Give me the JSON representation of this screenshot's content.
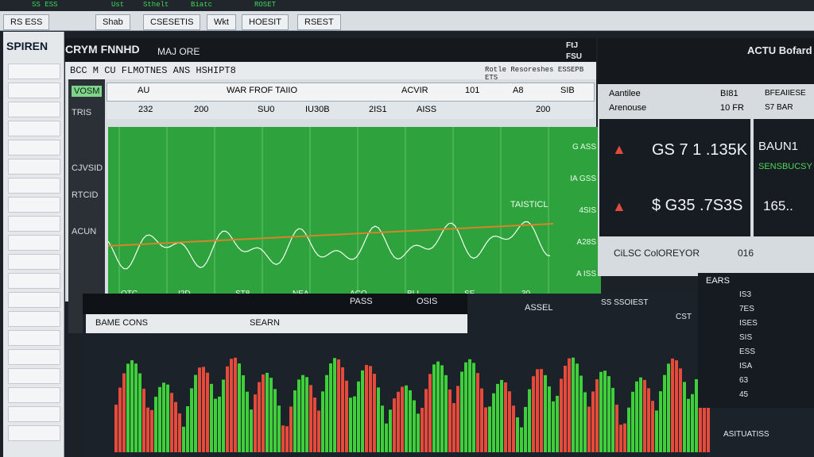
{
  "topbar": {
    "items": [
      "SS ESS",
      "Ust",
      "Sthelt",
      "Biatc",
      "ROSET"
    ]
  },
  "tabs": [
    "RS ESS",
    "Shab",
    "CSESETIS",
    "Wkt",
    "HOESIT",
    "RSEST"
  ],
  "sidebar": {
    "title": "SPIREN",
    "rows": [
      "",
      "",
      "",
      "",
      "",
      "",
      "",
      "",
      "",
      "",
      "",
      "",
      "",
      "",
      "",
      "",
      "",
      "",
      "",
      ""
    ]
  },
  "main_panel": {
    "title": "CRYM FNNHD",
    "subtitle": "MAJ ORE",
    "code_a": "FtJ",
    "code_b": "FSU",
    "header_strip": "BCC   M CU FLMOTNES ANS HSHIPT8",
    "header_right": "Rotle Resoreshes ESSEPB ETS",
    "toolbar": {
      "val_a": "AU",
      "label": "WAR FROF TAIIO",
      "sym": "ACVIR",
      "v1": "101",
      "v2": "A8",
      "v3": "SIB"
    },
    "row2": {
      "val_a": "232",
      "val_b": "200",
      "val_c": "SU0",
      "val_d": "IU30B",
      "val_e": "2IS1",
      "val_f": "AISS",
      "val_g": "200"
    },
    "side_labels": [
      "VOSM",
      "TRIS",
      "CJVSID",
      "RTCID",
      "ACUN"
    ],
    "chart_annotation": "TAISTICL",
    "x_ticks": [
      "OTC",
      "I2D",
      "ST8",
      "NEA",
      "ACO",
      "BLI",
      "SE",
      "30"
    ],
    "y_ticks": [
      "G ASS",
      "IA GSS",
      "4SIS",
      "A28S",
      "A ISS"
    ]
  },
  "info_panel": {
    "title": "ACTU Bofard",
    "top_labels": [
      "Aantilee",
      "BI81",
      "BFEAIIESE"
    ],
    "top_values": [
      "Arenouse",
      "10 FR",
      "S7 BAR"
    ],
    "metric_1": "GS 7 1 .135K",
    "metric_2": "$ G35 .7S3S",
    "side_a": "BAUN1",
    "side_b": "SENSBUCSY",
    "side_c": "165..",
    "footer": "CiLSC ColOREYOR",
    "footer_val": "016"
  },
  "bottom_panel": {
    "header_left": "BAME CONS",
    "header_mid": "SEARN",
    "header_right": "PASS",
    "header_far": "OSIS",
    "right_header": "ASSEL",
    "right_sub": "SS SSOIEST",
    "right_sub2": "CST",
    "footer": "ASITUATISS"
  },
  "orderbook": {
    "title": "EARS",
    "rows": [
      "IS3",
      "7ES",
      "ISES",
      "SIS",
      "ESS",
      "ISA",
      "63",
      "45"
    ]
  },
  "colors": {
    "up": "#3fcf3b",
    "down": "#e64a3b",
    "panel": "#171c22",
    "chart_bg": "#2ea33d"
  }
}
